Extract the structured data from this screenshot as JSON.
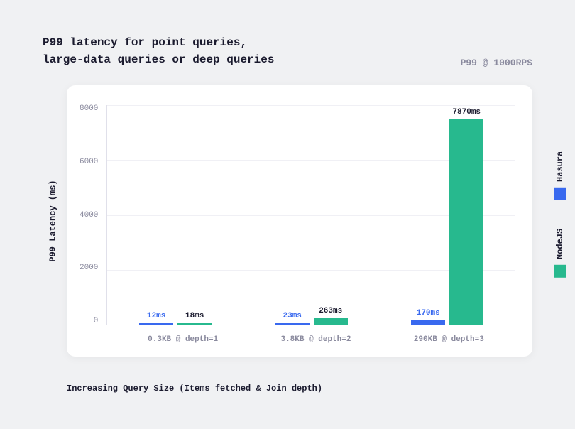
{
  "title_line1": "P99 latency for point queries,",
  "title_line2": "large-data queries or deep queries",
  "subtitle": "P99 @ 1000RPS",
  "ylabel": "P99 Latency (ms)",
  "xlabel": "Increasing Query Size (Items fetched & Join depth)",
  "yticks": [
    "8000",
    "6000",
    "4000",
    "2000",
    "0"
  ],
  "legend": {
    "hasura": "Hasura",
    "nodejs": "NodeJS"
  },
  "colors": {
    "hasura": "#3969ef",
    "nodejs": "#27b98e"
  },
  "chart_data": {
    "type": "bar",
    "title": "P99 latency for point queries, large-data queries or deep queries",
    "xlabel": "Increasing Query Size (Items fetched & Join depth)",
    "ylabel": "P99 Latency (ms)",
    "ylim": [
      0,
      8000
    ],
    "categories": [
      "0.3KB @ depth=1",
      "3.8KB @ depth=2",
      "290KB @ depth=3"
    ],
    "series": [
      {
        "name": "Hasura",
        "values": [
          12,
          23,
          170
        ],
        "labels": [
          "12ms",
          "23ms",
          "170ms"
        ]
      },
      {
        "name": "NodeJS",
        "values": [
          18,
          263,
          7870
        ],
        "labels": [
          "18ms",
          "263ms",
          "7870ms"
        ]
      }
    ]
  }
}
